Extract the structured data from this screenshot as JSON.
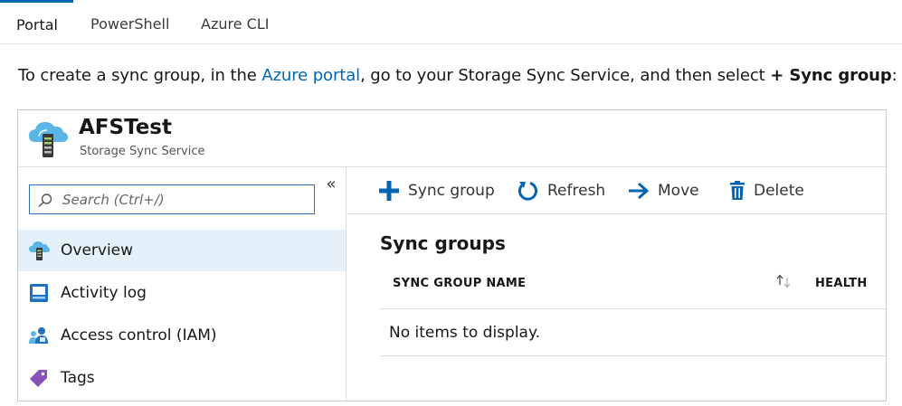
{
  "tabs": [
    {
      "label": "Portal",
      "active": true
    },
    {
      "label": "PowerShell",
      "active": false
    },
    {
      "label": "Azure CLI",
      "active": false
    }
  ],
  "intro": {
    "before_link": "To create a sync group, in the ",
    "link_text": "Azure portal",
    "after_link": ", go to your Storage Sync Service, and then select ",
    "emphasis": "+ Sync group",
    "end": ":"
  },
  "panel": {
    "title": "AFSTest",
    "subtitle": "Storage Sync Service",
    "icon": "storage-sync-service-icon"
  },
  "sidebar": {
    "search_placeholder": "Search (Ctrl+/)",
    "collapse_glyph": "«",
    "items": [
      {
        "label": "Overview",
        "icon": "overview-icon",
        "selected": true
      },
      {
        "label": "Activity log",
        "icon": "activity-log-icon",
        "selected": false
      },
      {
        "label": "Access control (IAM)",
        "icon": "access-control-icon",
        "selected": false
      },
      {
        "label": "Tags",
        "icon": "tag-icon",
        "selected": false
      }
    ]
  },
  "toolbar": {
    "sync_group_label": "Sync group",
    "refresh_label": "Refresh",
    "move_label": "Move",
    "delete_label": "Delete"
  },
  "main": {
    "section_title": "Sync groups",
    "columns": [
      "SYNC GROUP NAME",
      "HEALTH"
    ],
    "empty_text": "No items to display."
  },
  "colors": {
    "accent": "#0065b3",
    "selected_bg": "#e5f1fa",
    "border": "#dcdcdc"
  }
}
